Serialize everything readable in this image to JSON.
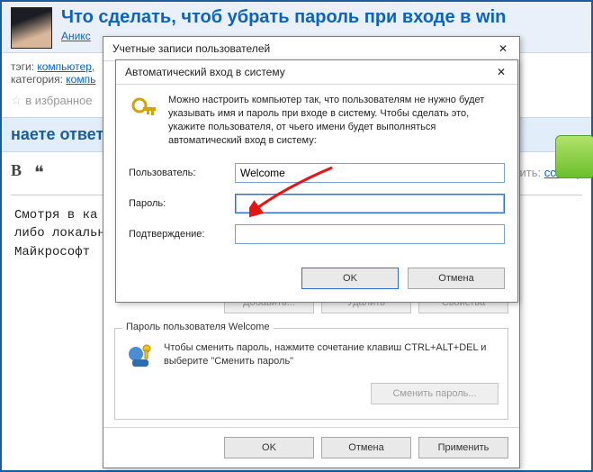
{
  "question": {
    "title": "Что сделать, чтоб убрать пароль при входе в win",
    "title_line2_prefix": "wind",
    "author": "Аникс ",
    "tags_label": "тэги: ",
    "tag_computer": "компьютер,",
    "category_label": "категория: ",
    "category_link": "компь",
    "fav_star": "☆",
    "fav_label": "в избранное"
  },
  "green_badge": "",
  "answer_header": "наете ответ",
  "toolbar": {
    "bold": "B",
    "quote": "❝",
    "add_label": "добавить:",
    "add_link": "ссылку"
  },
  "answer_text": "Смотря в кa                                                   ановке? Учетна\nлибо локальн\nМайкрософт",
  "ua_dialog": {
    "title": "Учетные записи пользователей",
    "btn_add": "Добавить...",
    "btn_remove": "Удалить",
    "btn_props": "Свойства",
    "group_label": "Пароль пользователя Welcome",
    "hint_text": "Чтобы сменить пароль, нажмите сочетание клавиш CTRL+ALT+DEL и выберите \"Сменить пароль\"",
    "btn_change_pw": "Сменить пароль...",
    "btn_ok": "OK",
    "btn_cancel": "Отмена",
    "btn_apply": "Применить"
  },
  "al_dialog": {
    "title": "Автоматический вход в систему",
    "desc": "Можно настроить компьютер так, что пользователям не нужно будет указывать имя и пароль при входе в систему. Чтобы сделать это, укажите пользователя, от чьего имени будет выполняться автоматический вход в систему:",
    "user_label": "Пользователь:",
    "user_value": "Welcome",
    "password_label": "Пароль:",
    "password_value": "",
    "confirm_label": "Подтверждение:",
    "confirm_value": "",
    "btn_ok": "OK",
    "btn_cancel": "Отмена"
  }
}
